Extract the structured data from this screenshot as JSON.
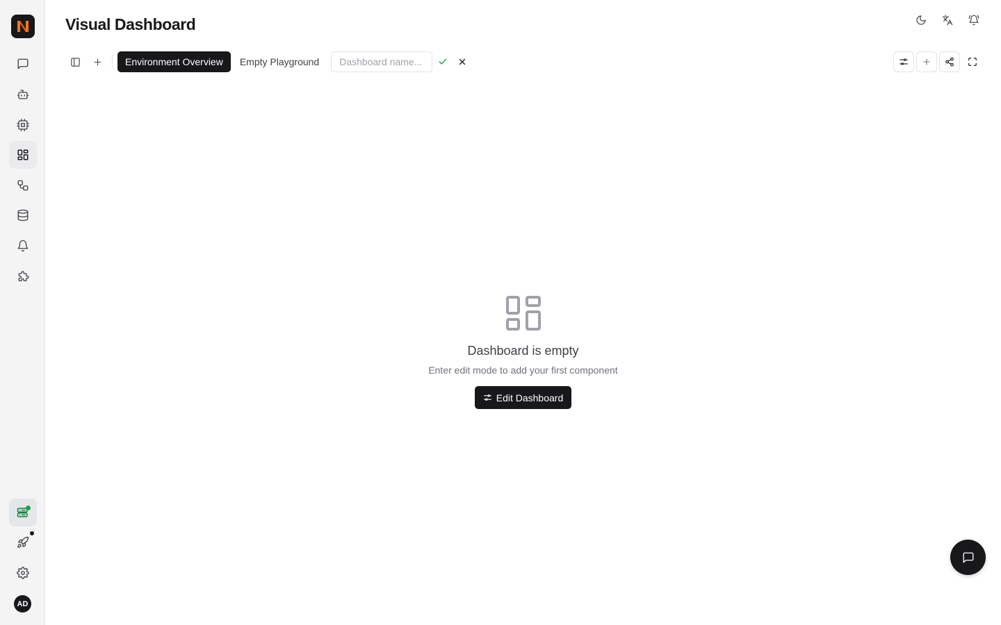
{
  "app": {
    "logo_icon": "app-logo-n",
    "brand_colors": {
      "primary": "#18181b",
      "accent_orange": "#f97316",
      "status_green": "#16a34a"
    }
  },
  "sidebar": {
    "items": [
      {
        "id": "chat",
        "icon": "message-square-icon"
      },
      {
        "id": "agents",
        "icon": "bot-icon"
      },
      {
        "id": "models",
        "icon": "cpu-icon"
      },
      {
        "id": "dashboard",
        "icon": "layout-dashboard-icon",
        "active": true
      },
      {
        "id": "workflows",
        "icon": "workflow-icon"
      },
      {
        "id": "data",
        "icon": "database-icon"
      },
      {
        "id": "alerts",
        "icon": "bell-icon"
      },
      {
        "id": "plugins",
        "icon": "puzzle-icon"
      }
    ],
    "bottom": [
      {
        "id": "environments",
        "icon": "server-status-icon"
      },
      {
        "id": "launch",
        "icon": "rocket-icon"
      },
      {
        "id": "settings",
        "icon": "settings-icon"
      }
    ],
    "user": {
      "initials": "AD"
    }
  },
  "header": {
    "title": "Visual Dashboard",
    "icons": [
      "moon-icon",
      "translate-icon",
      "bell-ring-icon"
    ]
  },
  "toolbar": {
    "tabs": [
      {
        "label": "Environment Overview",
        "active": true
      },
      {
        "label": "Empty Playground",
        "active": false
      }
    ],
    "name_input": {
      "value": "",
      "placeholder": "Dashboard name..."
    },
    "right_icons": [
      "edit-settings-icon",
      "plus-icon",
      "share-icon",
      "fullscreen-icon"
    ]
  },
  "empty_state": {
    "title": "Dashboard is empty",
    "subtitle": "Enter edit mode to add your first component",
    "button_label": "Edit Dashboard"
  }
}
